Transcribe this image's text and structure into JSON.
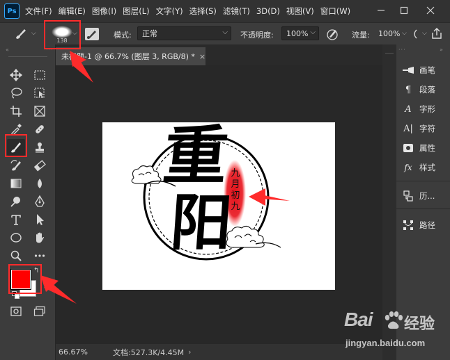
{
  "app": {
    "logo_text": "Ps",
    "menu": [
      "文件(F)",
      "编辑(E)",
      "图像(I)",
      "图层(L)",
      "文字(Y)",
      "选择(S)",
      "滤镜(T)",
      "3D(D)",
      "视图(V)",
      "窗口(W)"
    ]
  },
  "options": {
    "brush_size": "138",
    "mode_label": "模式:",
    "mode_value": "正常",
    "opacity_label": "不透明度:",
    "opacity_value": "100%",
    "flow_label": "流量:",
    "flow_value": "100%"
  },
  "document": {
    "tab_title": "未标题-1 @ 66.7% (图层 3, RGB/8) *",
    "tab_close": "×",
    "zoom": "66.67%",
    "doc_info": "文档:527.3K/4.45M",
    "foreground_color": "#ff0000",
    "background_color": "#ffffff"
  },
  "artwork": {
    "main_chars": [
      "重",
      "阳"
    ],
    "seal_text": [
      "九",
      "月",
      "初",
      "九"
    ]
  },
  "panels": [
    {
      "label": "画笔",
      "icon": "brush-panel-icon"
    },
    {
      "label": "段落",
      "icon": "paragraph-icon"
    },
    {
      "label": "字形",
      "icon": "glyphs-icon"
    },
    {
      "label": "字符",
      "icon": "character-icon"
    },
    {
      "label": "属性",
      "icon": "properties-icon"
    },
    {
      "label": "样式",
      "icon": "styles-icon"
    },
    {
      "label": "历...",
      "icon": "history-icon"
    },
    {
      "label": "路径",
      "icon": "paths-icon"
    }
  ],
  "watermark": {
    "brand": "Bai",
    "brand_suffix": "经验",
    "url": "jingyan.baidu.com"
  },
  "colors": {
    "accent_red": "#ff2b2b",
    "ps_blue": "#31a8ff"
  }
}
